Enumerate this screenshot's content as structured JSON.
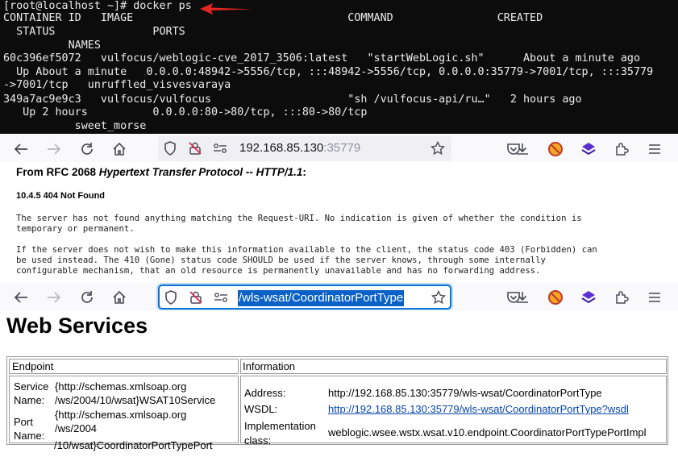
{
  "terminal": {
    "lines": [
      "[root@localhost ~]# docker ps",
      "CONTAINER ID   IMAGE                                 COMMAND                CREATED",
      "  STATUS               PORTS",
      "          NAMES",
      "60c396ef5072   vulfocus/weblogic-cve_2017_3506:latest   \"startWebLogic.sh\"      About a minute ago",
      "  Up About a minute   0.0.0.0:48942->5556/tcp, :::48942->5556/tcp, 0.0.0.0:35779->7001/tcp, :::35779",
      "->7001/tcp   unruffled_visvesvaraya",
      "349a7ac9e9c3   vulfocus/vulfocus                     \"sh /vulfocus-api/ru…\"   2 hours ago",
      "   Up 2 hours          0.0.0.0:80->80/tcp, :::80->80/tcp",
      "           sweet_morse"
    ],
    "annotation_color": "#e0241e"
  },
  "browser1": {
    "url_host": "192.168.85.130",
    "url_port": ":35779"
  },
  "page404": {
    "rfc_prefix": "From RFC 2068 ",
    "rfc_italic": "Hypertext Transfer Protocol -- HTTP/1.1",
    "rfc_suffix": ":",
    "section": "10.4.5 404 Not Found",
    "p1": [
      "The server has not found anything matching the Request-URI. No indication is given of whether the condition is",
      "temporary or permanent."
    ],
    "p2": [
      "If the server does not wish to make this information available to the client, the status code 403 (Forbidden) can",
      "be used instead. The 410 (Gone) status code SHOULD be used if the server knows, through some internally",
      "configurable mechanism, that an old resource is permanently unavailable and has no forwarding address."
    ]
  },
  "browser2": {
    "url_selected": "/wls-wsat/CoordinatorPortType"
  },
  "ws": {
    "title": "Web Services",
    "col_endpoint": "Endpoint",
    "col_information": "Information",
    "service_name_label": [
      "Service",
      "Name:"
    ],
    "service_name_value": [
      "{http://schemas.xmlsoap.org",
      "/ws/2004/10/wsat}WSAT10Service"
    ],
    "port_name_label": [
      "Port",
      "Name:"
    ],
    "port_name_value": [
      "{http://schemas.xmlsoap.org",
      "/ws/2004",
      "/10/wsat}CoordinatorPortTypePort"
    ],
    "address_label": "Address:",
    "address_value": "http://192.168.85.130:35779/wls-wsat/CoordinatorPortType",
    "wsdl_label": "WSDL:",
    "wsdl_value": "http://192.168.85.130:35779/wls-wsat/CoordinatorPortType?wsdl",
    "impl_label": [
      "Implementation",
      "class:"
    ],
    "impl_value": "weblogic.wsee.wstx.wsat.v10.endpoint.CoordinatorPortTypePortImpl"
  },
  "colors": {
    "terminal_bg": "#0c0c0c",
    "toolbar_bg": "#f9f9fb",
    "focus_ring": "#0a74d8",
    "link": "#0645ad"
  }
}
